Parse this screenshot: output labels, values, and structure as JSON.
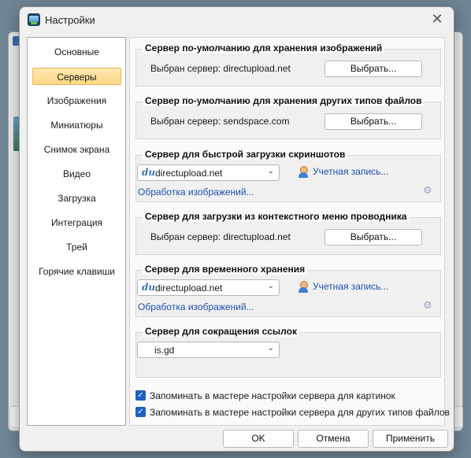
{
  "window": {
    "title": "Настройки",
    "close_symbol": "✕"
  },
  "sidebar": {
    "items": [
      {
        "label": "Основные"
      },
      {
        "label": "Серверы"
      },
      {
        "label": "Изображения"
      },
      {
        "label": "Миниатюры"
      },
      {
        "label": "Снимок экрана"
      },
      {
        "label": "Видео"
      },
      {
        "label": "Загрузка"
      },
      {
        "label": "Интеграция"
      },
      {
        "label": "Трей"
      },
      {
        "label": "Горячие клавиши"
      }
    ],
    "selected": "Серверы"
  },
  "groups": {
    "images": {
      "title": "Сервер по-умолчанию для хранения изображений",
      "selected_label": "Выбран сервер: directupload.net",
      "button": "Выбрать..."
    },
    "files": {
      "title": "Сервер по-умолчанию для хранения других типов файлов",
      "selected_label": "Выбран сервер: sendspace.com",
      "button": "Выбрать..."
    },
    "screenshots": {
      "title": "Сервер для быстрой загрузки скриншотов",
      "server": "directupload.net",
      "server_icon": "du",
      "account_link": "Учетная запись...",
      "processing_link": "Обработка изображений..."
    },
    "context_menu": {
      "title": "Сервер для загрузки из контекстного меню проводника",
      "selected_label": "Выбран сервер: directupload.net",
      "button": "Выбрать..."
    },
    "temporary": {
      "title": "Сервер для временного хранения",
      "server": "directupload.net",
      "server_icon": "du",
      "account_link": "Учетная запись...",
      "processing_link": "Обработка изображений..."
    },
    "shortener": {
      "title": "Сервер для сокращения ссылок",
      "server": "is.gd"
    }
  },
  "checkboxes": {
    "remember_images": {
      "label": "Запоминать в мастере настройки сервера для картинок",
      "checked": true
    },
    "remember_files": {
      "label": "Запоминать в мастере настройки сервера для других типов файлов",
      "checked": true
    }
  },
  "footer": {
    "ok": "OK",
    "cancel": "Отмена",
    "apply": "Применить"
  },
  "colors": {
    "accent": "#1f5fbf",
    "link": "#1f4fb3",
    "selection": "#fbd785"
  }
}
